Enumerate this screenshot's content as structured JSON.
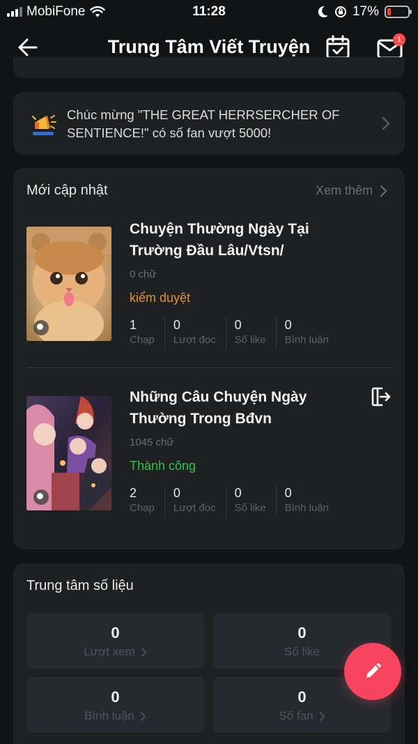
{
  "status_bar": {
    "carrier": "MobiFone",
    "time": "11:28",
    "battery_percent": "17%",
    "battery_level": 0.17
  },
  "header": {
    "title": "Trung Tâm Viết Truyện",
    "mail_badge": "1"
  },
  "notice": {
    "text": "Chúc mừng \"THE GREAT HERRSERCHER OF SENTIENCE!\" có số fan vượt 5000!"
  },
  "updates": {
    "title": "Mới cập nhật",
    "see_more": "Xem thêm",
    "books": [
      {
        "title": "Chuyện Thường Ngày Tại Trường Đầu Lâu/Vtsn/",
        "words": "0 chữ",
        "status": "kiểm duyệt",
        "stats": [
          {
            "value": "1",
            "label": "Chap"
          },
          {
            "value": "0",
            "label": "Lượt đọc"
          },
          {
            "value": "0",
            "label": "Số like"
          },
          {
            "value": "0",
            "label": "Bình luận"
          }
        ]
      },
      {
        "title": "Những Câu Chuyện Ngày Thường Trong Bđvn",
        "words": "1045 chữ",
        "status": "Thành công",
        "stats": [
          {
            "value": "2",
            "label": "Chap"
          },
          {
            "value": "0",
            "label": "Lượt đọc"
          },
          {
            "value": "0",
            "label": "Số like"
          },
          {
            "value": "0",
            "label": "Bình luận"
          }
        ]
      }
    ]
  },
  "metrics": {
    "title": "Trung tâm số liệu",
    "items": [
      {
        "value": "0",
        "label": "Lượt xem"
      },
      {
        "value": "0",
        "label": "Số like"
      },
      {
        "value": "0",
        "label": "Bình luận"
      },
      {
        "value": "0",
        "label": "Số fan"
      }
    ]
  },
  "colors": {
    "background": "#121314",
    "card": "#1f2022",
    "status_review": "#e0913a",
    "status_success": "#36c24a",
    "fab": "#f7455f",
    "badge": "#ff4d4f"
  },
  "icons": {
    "back": "arrow-left-icon",
    "calendar": "calendar-check-icon",
    "mail": "mail-icon",
    "notice": "megaphone-icon",
    "export": "exit-door-icon",
    "fab": "pencil-icon"
  }
}
